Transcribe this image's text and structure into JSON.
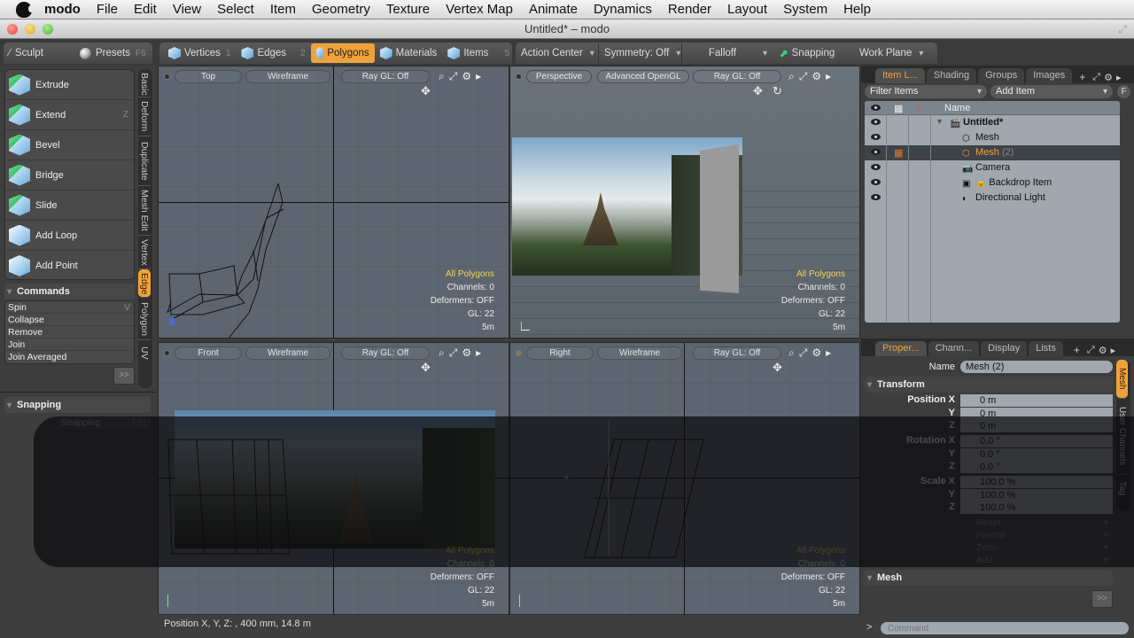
{
  "menubar": {
    "app": "modo",
    "items": [
      "File",
      "Edit",
      "View",
      "Select",
      "Item",
      "Geometry",
      "Texture",
      "Vertex Map",
      "Animate",
      "Dynamics",
      "Render",
      "Layout",
      "System",
      "Help"
    ]
  },
  "window": {
    "title": "Untitled* – modo"
  },
  "toolbar": {
    "sculpt": "Sculpt",
    "presets": "Presets",
    "presets_key": "F6",
    "modes": [
      {
        "label": "Vertices",
        "key": "1"
      },
      {
        "label": "Edges",
        "key": "2"
      },
      {
        "label": "Polygons",
        "key": "",
        "active": true
      },
      {
        "label": "Materials",
        "key": ""
      },
      {
        "label": "Items",
        "key": "5"
      }
    ],
    "action_center": "Action Center",
    "symmetry": "Symmetry: Off",
    "falloff": "Falloff",
    "snapping": "Snapping",
    "work_plane": "Work Plane"
  },
  "left_panel": {
    "tools": [
      {
        "label": "Extrude",
        "key": ""
      },
      {
        "label": "Extend",
        "key": "Z"
      },
      {
        "label": "Bevel",
        "key": ""
      },
      {
        "label": "Bridge",
        "key": ""
      },
      {
        "label": "Slide",
        "key": ""
      },
      {
        "label": "Add Loop",
        "key": ""
      },
      {
        "label": "Add Point",
        "key": ""
      }
    ],
    "vertical_tabs": [
      "Basic",
      "Deform",
      "Duplicate",
      "Mesh Edit",
      "Vertex",
      "Edge",
      "Polygon",
      "UV"
    ],
    "active_vertical_tab": "Edge",
    "commands_header": "Commands",
    "commands": [
      {
        "label": "Spin",
        "key": "V"
      },
      {
        "label": "Collapse",
        "key": ""
      },
      {
        "label": "Remove",
        "key": ""
      },
      {
        "label": "Join",
        "key": ""
      },
      {
        "label": "Join Averaged",
        "key": ""
      }
    ],
    "more_label": ">>",
    "snapping_header": "Snapping",
    "snapping_sub": "Snapping",
    "snapping_sub_key": "F11"
  },
  "viewports": [
    {
      "view": "Top",
      "shading": "Wireframe",
      "raygl": "Ray GL: Off",
      "info": {
        "selection": "All Polygons",
        "channels": "Channels: 0",
        "deformers": "Deformers: OFF",
        "gl": "GL: 22",
        "scale": "5m"
      }
    },
    {
      "view": "Perspective",
      "shading": "Advanced OpenGL",
      "raygl": "Ray GL: Off",
      "info": {
        "selection": "All Polygons",
        "channels": "Channels: 0",
        "deformers": "Deformers: OFF",
        "gl": "GL: 22",
        "scale": "5m"
      }
    },
    {
      "view": "Front",
      "shading": "Wireframe",
      "raygl": "Ray GL: Off",
      "info": {
        "selection": "All Polygons",
        "channels": "Channels: 0",
        "deformers": "Deformers: OFF",
        "gl": "GL: 22",
        "scale": "5m"
      }
    },
    {
      "view": "Right",
      "shading": "Wireframe",
      "raygl": "Ray GL: Off",
      "info": {
        "selection": "All Polygons",
        "channels": "Channels: 0",
        "deformers": "Deformers: OFF",
        "gl": "GL: 22",
        "scale": "5m"
      }
    }
  ],
  "item_list": {
    "tabs": [
      "Item L...",
      "Shading",
      "Groups",
      "Images"
    ],
    "active_tab": "Item L...",
    "filter": "Filter Items",
    "add_item": "Add Item",
    "f_button": "F",
    "name_header": "Name",
    "items": [
      {
        "name": "Untitled*",
        "suffix": "",
        "icon": "scene-icon",
        "indent": 0,
        "bold": true,
        "selected": false
      },
      {
        "name": "Mesh",
        "suffix": "",
        "icon": "mesh-icon",
        "indent": 1,
        "bold": false,
        "selected": false
      },
      {
        "name": "Mesh",
        "suffix": "(2)",
        "icon": "mesh-icon",
        "indent": 1,
        "bold": false,
        "selected": true
      },
      {
        "name": "Camera",
        "suffix": "",
        "icon": "camera-icon",
        "indent": 1,
        "bold": false,
        "selected": false
      },
      {
        "name": "Backdrop Item",
        "suffix": "",
        "icon": "backdrop-icon",
        "indent": 1,
        "bold": false,
        "selected": false,
        "locked": true
      },
      {
        "name": "Directional Light",
        "suffix": "",
        "icon": "light-icon",
        "indent": 1,
        "bold": false,
        "selected": false
      }
    ]
  },
  "properties": {
    "tabs": [
      "Proper...",
      "Chann...",
      "Display",
      "Lists"
    ],
    "active_tab": "Proper...",
    "name_label": "Name",
    "name_value": "Mesh (2)",
    "transform_header": "Transform",
    "position": {
      "label": "Position X",
      "x": "0 m",
      "y": "0 m",
      "z": "0 m"
    },
    "rotation": {
      "label": "Rotation X",
      "x": "0.0 °",
      "y": "0.0 °",
      "z": "0.0 °"
    },
    "scale": {
      "label": "Scale X",
      "x": "100.0 %",
      "y": "100.0 %",
      "z": "100.0 %"
    },
    "axis_y": "Y",
    "axis_z": "Z",
    "menus": [
      "Reset",
      "Freeze",
      "Zero",
      "Add"
    ],
    "mesh_header": "Mesh",
    "more_label": ">>",
    "side_tabs": [
      "Mesh",
      "User Channels",
      "Tag"
    ],
    "active_side_tab": "Mesh"
  },
  "statusbar": {
    "text": "Position X, Y, Z:   , 400 mm, 14.8 m"
  },
  "command": {
    "prompt": ">",
    "placeholder": "Command"
  },
  "colors": {
    "accent": "#f0a23a",
    "selection_text": "#f4d25a",
    "viewport_bg": "#5d6670"
  }
}
